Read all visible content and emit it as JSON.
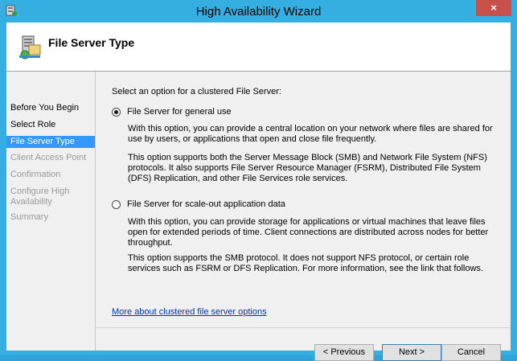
{
  "window": {
    "title": "High Availability Wizard",
    "close_label": "×"
  },
  "header": {
    "title": "File Server Type"
  },
  "nav": {
    "items": [
      {
        "label": "Before You Begin"
      },
      {
        "label": "Select Role"
      },
      {
        "label": "File Server Type"
      },
      {
        "label": "Client Access Point"
      },
      {
        "label": "Confirmation"
      },
      {
        "label": "Configure High Availability"
      },
      {
        "label": "Summary"
      }
    ]
  },
  "main": {
    "prompt": "Select an option for a clustered File Server:",
    "options": [
      {
        "label": "File Server for general use",
        "selected": true,
        "desc1": "With this option, you can provide a central location on your network where files are shared for use by users, or applications that open and close file frequently.",
        "desc2": "This option supports both the Server Message Block (SMB) and Network File System (NFS) protocols. It also supports File Server Resource Manager (FSRM), Distributed File System (DFS) Replication, and other File Services role services."
      },
      {
        "label": "File Server for scale-out application data",
        "selected": false,
        "desc1": "With this option, you can provide storage for applications or virtual machines that leave files open for extended periods of time. Client connections are distributed across nodes for better throughput.",
        "desc2": "This option supports the SMB protocol. It does not support NFS protocol, or certain role services such as FSRM or DFS Replication. For more information, see the link that follows."
      }
    ],
    "link": "More about clustered file server options"
  },
  "buttons": {
    "previous": "< Previous",
    "next": "Next >",
    "cancel": "Cancel"
  },
  "colors": {
    "titlebar": "#35aee2",
    "active_nav": "#3399ff",
    "link": "#0033bb",
    "close": "#c7504a"
  }
}
